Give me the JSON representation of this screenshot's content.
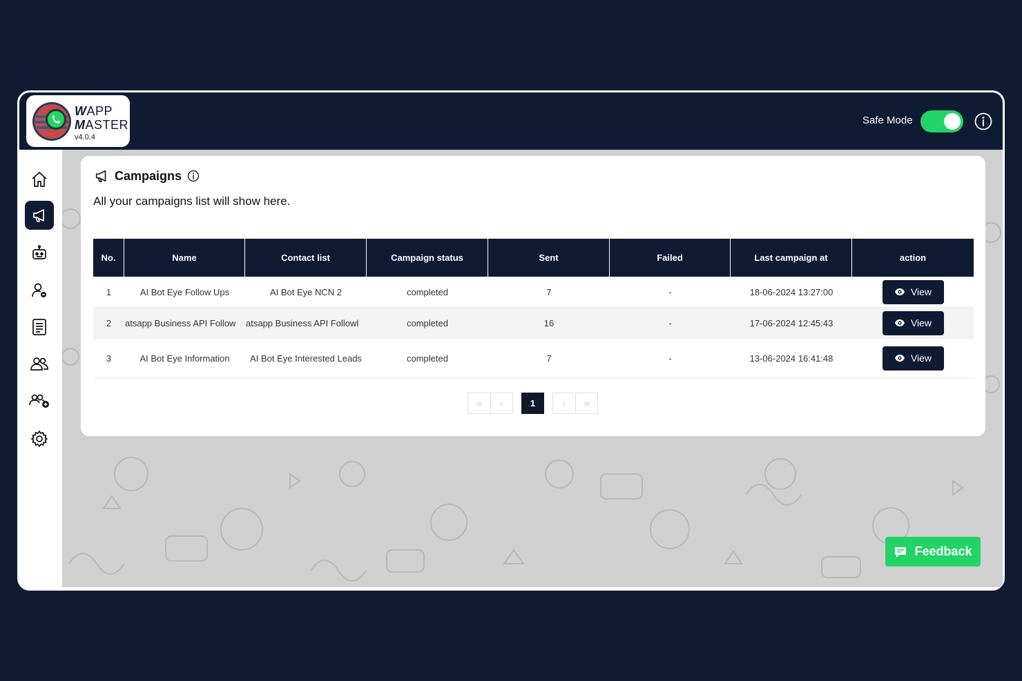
{
  "app": {
    "logo_word1_first": "W",
    "logo_word1_rest": "APP",
    "logo_word2_first": "M",
    "logo_word2_rest": "ASTER",
    "version": "v4.0.4"
  },
  "topbar": {
    "safe_mode_label": "Safe Mode",
    "safe_mode_on": true
  },
  "sidebar": {
    "items": [
      {
        "icon": "home-icon",
        "active": false
      },
      {
        "icon": "megaphone-icon",
        "active": true
      },
      {
        "icon": "robot-icon",
        "active": false
      },
      {
        "icon": "user-remove-icon",
        "active": false
      },
      {
        "icon": "list-icon",
        "active": false
      },
      {
        "icon": "users-icon",
        "active": false
      },
      {
        "icon": "user-add-group-icon",
        "active": false
      },
      {
        "icon": "gear-icon",
        "active": false
      }
    ]
  },
  "page": {
    "title": "Campaigns",
    "subtitle": "All your campaigns list will show here."
  },
  "table": {
    "headers": [
      "No.",
      "Name",
      "Contact list",
      "Campaign status",
      "Sent",
      "Failed",
      "Last campaign at",
      "action"
    ],
    "rows": [
      {
        "no": "1",
        "name": "AI Bot Eye Follow Ups",
        "contact_list": "AI Bot Eye NCN 2",
        "status": "completed",
        "sent": "7",
        "failed": "-",
        "last": "18-06-2024 13:27:00",
        "action": "View"
      },
      {
        "no": "2",
        "name": "atsapp Business API Follow",
        "contact_list": "atsapp Business API Followl",
        "status": "completed",
        "sent": "16",
        "failed": "-",
        "last": "17-06-2024 12:45:43",
        "action": "View"
      },
      {
        "no": "3",
        "name": "AI Bot Eye Information",
        "contact_list": "AI Bot Eye Interested Leads",
        "status": "completed",
        "sent": "7",
        "failed": "-",
        "last": "13-06-2024 16:41:48",
        "action": "View"
      }
    ]
  },
  "pagination": {
    "first": "«",
    "prev": "‹",
    "current": "1",
    "next": "›",
    "last": "»"
  },
  "feedback_label": "Feedback",
  "colors": {
    "navy": "#0f1b33",
    "green": "#22d466"
  }
}
